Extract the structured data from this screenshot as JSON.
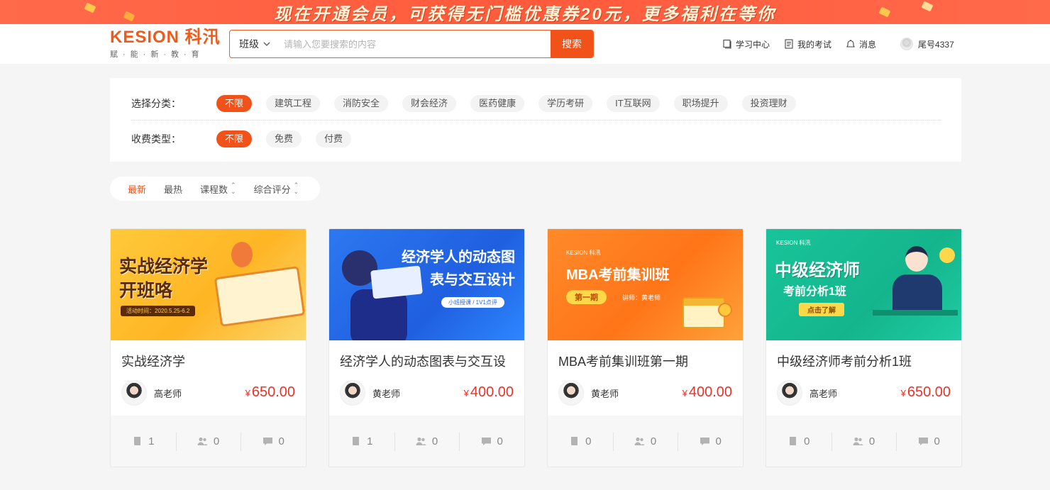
{
  "promo": {
    "text": "现在开通会员，可获得无门槛优惠券20元，更多福利在等你"
  },
  "header": {
    "logo_main": "KESION 科汛",
    "logo_sub": "赋·能·新·教·育",
    "search": {
      "category": "班级",
      "placeholder": "请输入您要搜索的内容",
      "button": "搜索"
    },
    "nav": [
      {
        "label": "学习中心",
        "icon": "book-icon"
      },
      {
        "label": "我的考试",
        "icon": "exam-icon"
      },
      {
        "label": "消息",
        "icon": "bell-icon"
      }
    ],
    "user": {
      "name": "尾号4337"
    }
  },
  "filters": {
    "category_label": "选择分类：",
    "categories": [
      "不限",
      "建筑工程",
      "消防安全",
      "财会经济",
      "医药健康",
      "学历考研",
      "IT互联网",
      "职场提升",
      "投资理财"
    ],
    "fee_label": "收费类型：",
    "fees": [
      "不限",
      "免费",
      "付费"
    ]
  },
  "sort": {
    "items": [
      "最新",
      "最热",
      "课程数",
      "综合评分"
    ]
  },
  "colors": {
    "accent": "#f0521a",
    "price": "#e8332a"
  },
  "courses": [
    {
      "cover_title": "实战经济学\n开班咯",
      "cover_sub": "活动时间：2020.5.25-6.2",
      "title": "实战经济学",
      "teacher": "高老师",
      "price": "650.00",
      "lessons": "1",
      "students": "0",
      "comments": "0"
    },
    {
      "cover_title": "经济学人的动态图\n表与交互设计",
      "cover_sub": "小班授课 / 1V1点评",
      "title": "经济学人的动态图表与交互设",
      "teacher": "黄老师",
      "price": "400.00",
      "lessons": "1",
      "students": "0",
      "comments": "0"
    },
    {
      "cover_brand": "KESION 科汛",
      "cover_title": "MBA考前集训班",
      "cover_tag": "第一期",
      "cover_sub": "讲师：黄老师",
      "title": "MBA考前集训班第一期",
      "teacher": "黄老师",
      "price": "400.00",
      "lessons": "0",
      "students": "0",
      "comments": "0"
    },
    {
      "cover_brand": "KESION 科汛",
      "cover_title": "中级经济师",
      "cover_sub": "考前分析1班",
      "cover_tag": "点击了解",
      "title": "中级经济师考前分析1班",
      "teacher": "高老师",
      "price": "650.00",
      "lessons": "0",
      "students": "0",
      "comments": "0"
    }
  ],
  "currency": "¥"
}
